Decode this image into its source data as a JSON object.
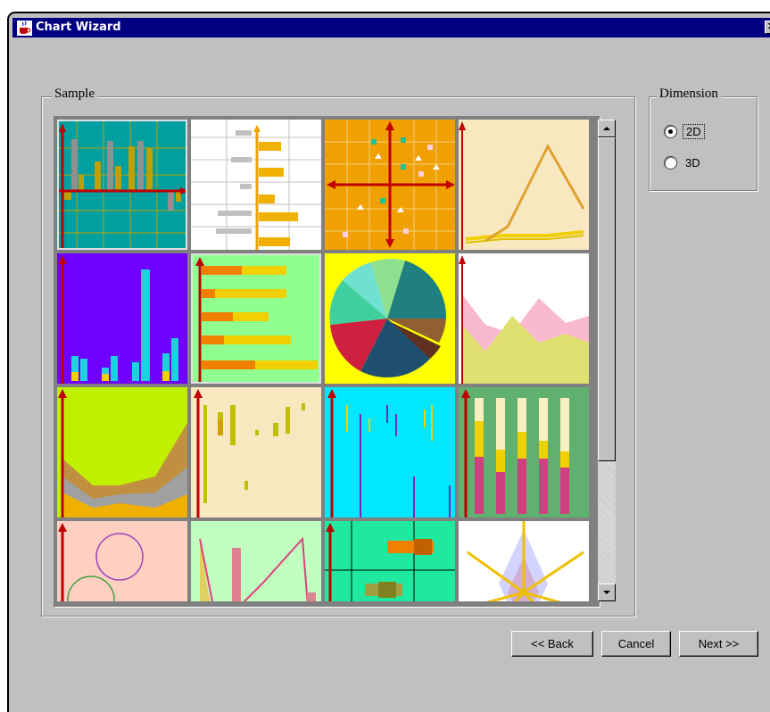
{
  "window": {
    "title": "Chart Wizard"
  },
  "sample_group": {
    "label": "Sample"
  },
  "dimension_group": {
    "label": "Dimension",
    "options": [
      {
        "label": "2D",
        "selected": true
      },
      {
        "label": "3D",
        "selected": false
      }
    ]
  },
  "buttons": {
    "back": "<< Back",
    "cancel": "Cancel",
    "next": "Next >>"
  },
  "thumbnails": [
    "bar-chart-teal",
    "horizontal-bar-white",
    "scatter-orange",
    "line-chart-peach",
    "3d-bar-purple",
    "horizontal-3d-bar-green",
    "pie-chart-yellow",
    "area-chart-white",
    "stacked-area-lime",
    "candlestick-peach",
    "hilo-cyan",
    "stacked-bar-green",
    "bubble-peach",
    "area-pink-lightgreen",
    "gantt-teal",
    "radar-white"
  ],
  "colors": {
    "titlebar": "#000080",
    "dialog": "#c0c0c0",
    "axis": "#c00000"
  }
}
